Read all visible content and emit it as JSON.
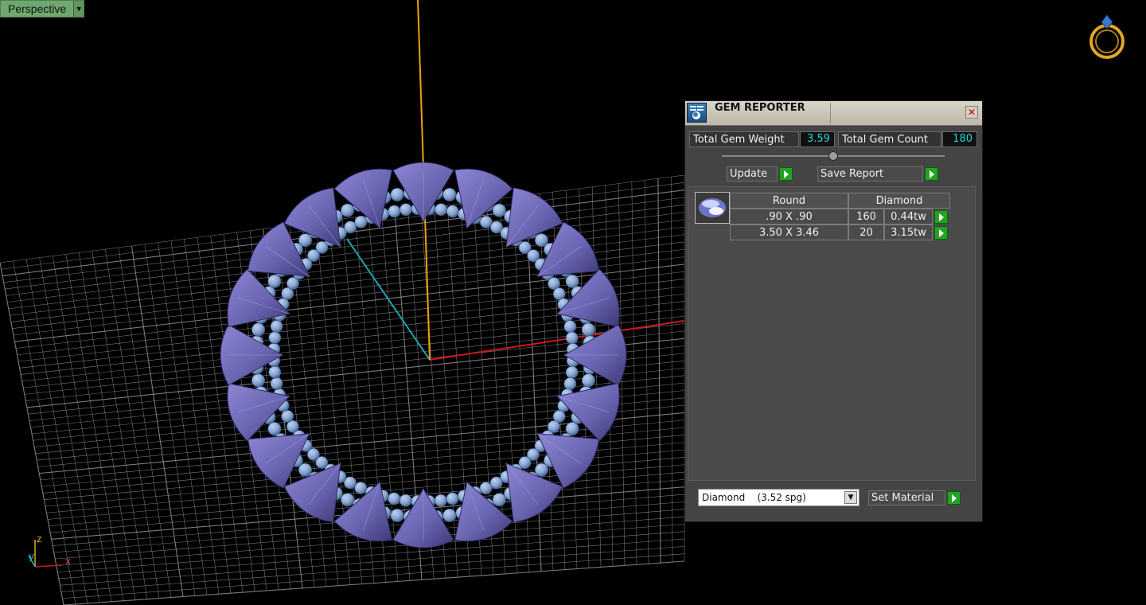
{
  "viewport": {
    "label": "Perspective",
    "dropdown_icon": "triangle-down-icon",
    "orientation_icon": "ring-icon",
    "axes": {
      "x": "x",
      "y": "y",
      "z": "z"
    },
    "colors": {
      "background": "#000000",
      "grid": "#9a9a9a",
      "axis_x": "#d01818",
      "axis_y": "#1ca2b0",
      "axis_z": "#f0a010",
      "large_gem": "#6b66b2",
      "small_gem": "#8aa7d4"
    }
  },
  "gem_reporter": {
    "title": "GEM REPORTER",
    "close_icon": "close-icon",
    "total_weight_label": "Total Gem Weight",
    "total_weight_value": "3.59",
    "total_count_label": "Total Gem Count",
    "total_count_value": "180",
    "update_label": "Update",
    "save_report_label": "Save Report",
    "table": {
      "headers": [
        "Round",
        "Diamond"
      ],
      "rows": [
        {
          "size": ".90 X .90",
          "count": "160",
          "weight": "0.44tw"
        },
        {
          "size": "3.50 X 3.46",
          "count": "20",
          "weight": "3.15tw"
        }
      ]
    },
    "material_value": "Diamond    (3.52 spg)",
    "set_material_label": "Set Material"
  }
}
